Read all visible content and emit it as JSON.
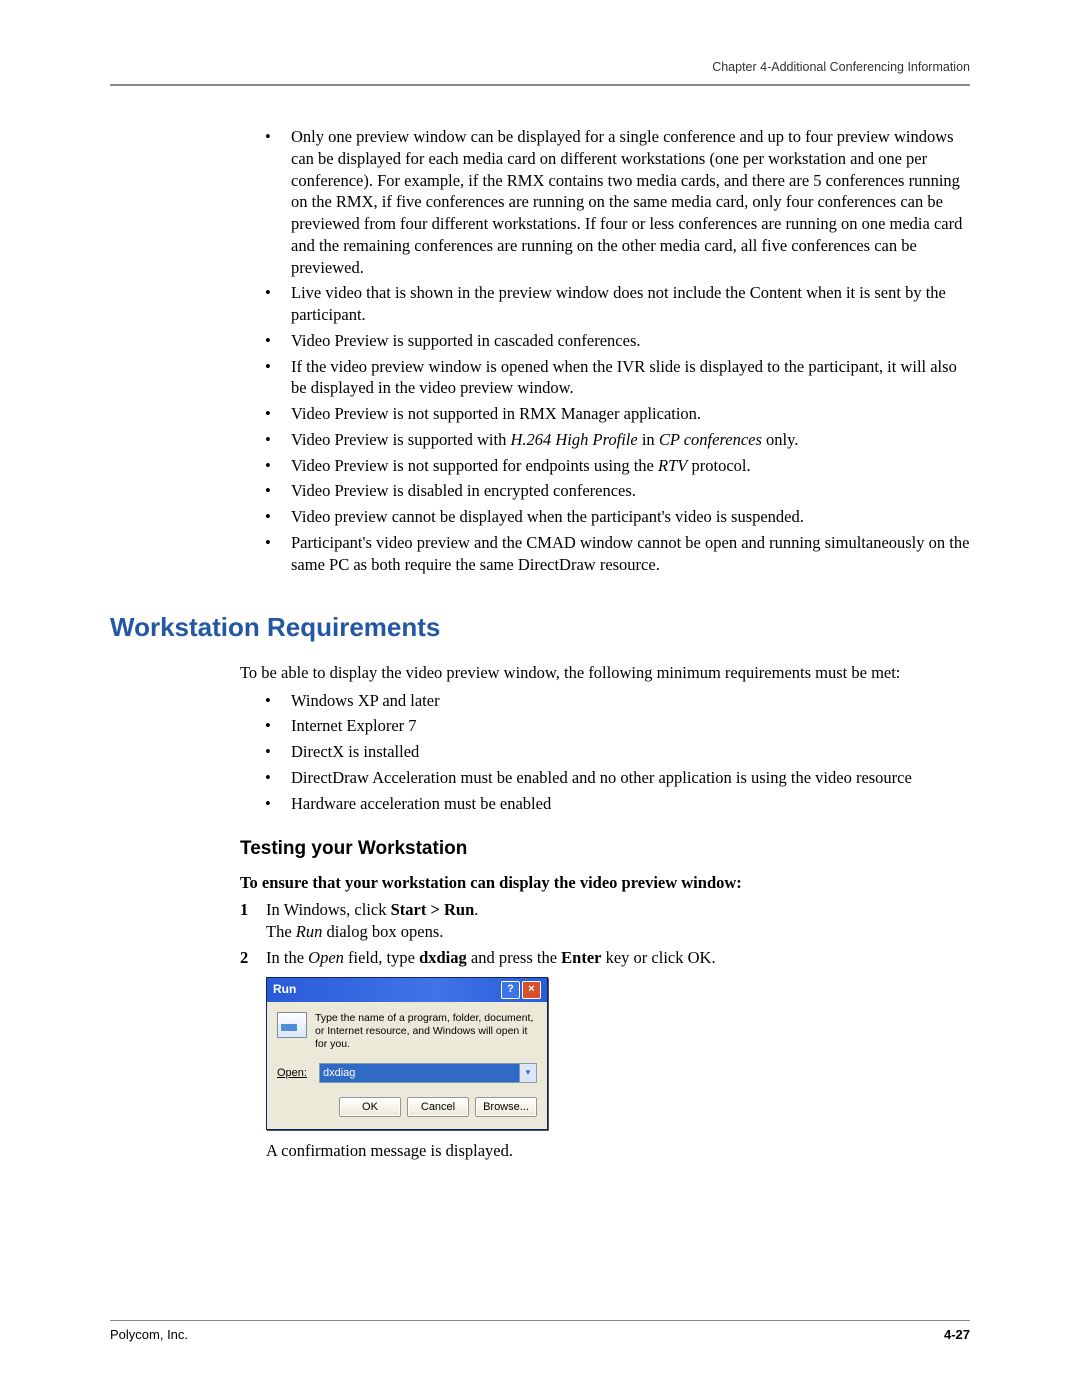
{
  "header": {
    "chapter": "Chapter 4-Additional Conferencing Information"
  },
  "top_bullets": [
    {
      "text": "Only one preview window can be displayed for a single conference and up to four preview windows can be displayed for each media card on different workstations (one per workstation and one per conference). For example, if the RMX contains two media cards, and there are 5 conferences running on the RMX, if five conferences are running on the same media card, only four conferences can be previewed from four different workstations. If four or less conferences are running on one media card and the remaining conferences are running on the other media card, all five conferences can be previewed."
    },
    {
      "text": "Live video that is shown in the preview window does not include the Content when it is sent by the participant."
    },
    {
      "text": "Video Preview is supported in cascaded conferences."
    },
    {
      "text": "If the video preview window is opened when the IVR slide is displayed to the participant, it will also be displayed in the video preview window."
    },
    {
      "text": "Video Preview is not supported in RMX Manager application."
    },
    {
      "pre": "Video Preview is supported with ",
      "ital": "H.264 High Profile",
      "mid": " in ",
      "ital2": "CP conferences",
      "post": " only."
    },
    {
      "pre": "Video Preview is not supported for endpoints using the ",
      "ital": "RTV",
      "post": " protocol."
    },
    {
      "text": "Video Preview is disabled in encrypted conferences."
    },
    {
      "text": "Video preview cannot be displayed when the participant's video is suspended."
    },
    {
      "text": "Participant's video preview and the CMAD window cannot be open and running simultaneously on the same PC as both require the same DirectDraw resource."
    }
  ],
  "section": {
    "h2": "Workstation Requirements",
    "intro": "To be able to display the video preview window, the following minimum requirements must be met:",
    "req_bullets": [
      "Windows XP and later",
      "Internet Explorer 7",
      "DirectX is installed",
      "DirectDraw Acceleration must be enabled and no other application is using the video resource",
      "Hardware acceleration must be enabled"
    ],
    "h3": "Testing your Workstation",
    "lead": "To ensure that your workstation can display the video preview window:",
    "steps": {
      "s1_pre": "In Windows, click ",
      "s1_bold": "Start > Run",
      "s1_post": ".",
      "s1_line2_pre": "The ",
      "s1_line2_ital": "Run",
      "s1_line2_post": " dialog box opens.",
      "s2_pre": "In the ",
      "s2_ital": "Open",
      "s2_mid": " field, type ",
      "s2_bold": "dxdiag",
      "s2_mid2": " and press the ",
      "s2_bold2": "Enter",
      "s2_post": " key or click OK."
    },
    "after_image": "A confirmation message is displayed."
  },
  "dialog": {
    "title": "Run",
    "desc": "Type the name of a program, folder, document, or Internet resource, and Windows will open it for you.",
    "open_label": "Open:",
    "open_value": "dxdiag",
    "ok": "OK",
    "cancel": "Cancel",
    "browse": "Browse..."
  },
  "footer": {
    "left": "Polycom, Inc.",
    "right": "4-27"
  }
}
